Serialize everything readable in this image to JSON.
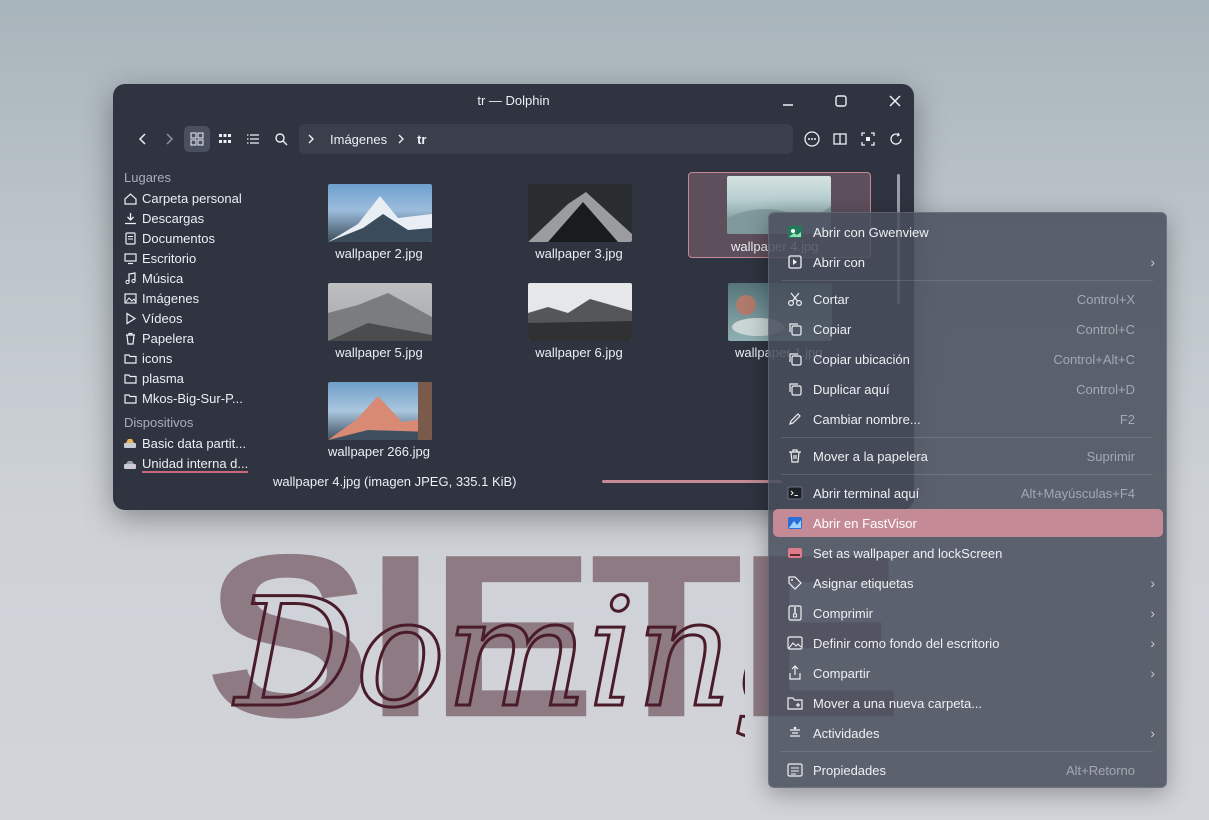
{
  "window": {
    "title": "tr — Dolphin"
  },
  "toolbar": {
    "breadcrumb": [
      "Imágenes",
      "tr"
    ]
  },
  "sidebar": {
    "places_title": "Lugares",
    "places": [
      {
        "label": "Carpeta personal",
        "icon": "home-icon"
      },
      {
        "label": "Descargas",
        "icon": "download-icon"
      },
      {
        "label": "Documentos",
        "icon": "document-icon"
      },
      {
        "label": "Escritorio",
        "icon": "desktop-icon"
      },
      {
        "label": "Música",
        "icon": "music-icon"
      },
      {
        "label": "Imágenes",
        "icon": "image-icon"
      },
      {
        "label": "Vídeos",
        "icon": "video-icon"
      },
      {
        "label": "Papelera",
        "icon": "trash-icon"
      },
      {
        "label": "icons",
        "icon": "folder-icon"
      },
      {
        "label": "plasma",
        "icon": "folder-icon"
      },
      {
        "label": "Mkos-Big-Sur-P...",
        "icon": "folder-icon"
      }
    ],
    "devices_title": "Dispositivos",
    "devices": [
      {
        "label": "Basic data partit...",
        "icon": "drive-icon"
      },
      {
        "label": "Unidad interna d...",
        "icon": "drive-icon"
      }
    ]
  },
  "files": [
    {
      "name": "wallpaper 2.jpg",
      "palette": [
        "#6f9fcf",
        "#e8eef4",
        "#3a4b5b"
      ]
    },
    {
      "name": "wallpaper 3.jpg",
      "palette": [
        "#2a2d30",
        "#d8dadc",
        "#1a1b1d"
      ]
    },
    {
      "name": "wallpaper 4.jpg",
      "palette": [
        "#b8cfd1",
        "#8fa7ab",
        "#6f8a8e"
      ]
    },
    {
      "name": "wallpaper 5.jpg",
      "palette": [
        "#bdbfc1",
        "#7a7c7e",
        "#4a4c4e"
      ]
    },
    {
      "name": "wallpaper 6.jpg",
      "palette": [
        "#e6e7e8",
        "#545658",
        "#2f3133"
      ]
    },
    {
      "name": "wallpaper 1.jpg",
      "palette": [
        "#55757a",
        "#b07a6c",
        "#8fb0b3"
      ]
    },
    {
      "name": "wallpaper 266.jpg",
      "palette": [
        "#6e9ec8",
        "#d98a74",
        "#3f4f5f"
      ]
    }
  ],
  "status": {
    "text": "wallpaper 4.jpg (imagen JPEG, 335.1 KiB)"
  },
  "context_menu": {
    "items": [
      {
        "label": "Abrir con Gwenview",
        "shortcut": "",
        "submenu": false,
        "icon": "gwenview-icon"
      },
      {
        "label": "Abrir con",
        "shortcut": "",
        "submenu": true,
        "icon": "open-with-icon"
      },
      {
        "label": "Cortar",
        "shortcut": "Control+X",
        "submenu": false,
        "icon": "cut-icon"
      },
      {
        "label": "Copiar",
        "shortcut": "Control+C",
        "submenu": false,
        "icon": "copy-icon"
      },
      {
        "label": "Copiar ubicación",
        "shortcut": "Control+Alt+C",
        "submenu": false,
        "icon": "copy-location-icon"
      },
      {
        "label": "Duplicar aquí",
        "shortcut": "Control+D",
        "submenu": false,
        "icon": "duplicate-icon"
      },
      {
        "label": "Cambiar nombre...",
        "shortcut": "F2",
        "submenu": false,
        "icon": "rename-icon"
      },
      {
        "label": "Mover a la papelera",
        "shortcut": "Suprimir",
        "submenu": false,
        "icon": "trash-icon"
      },
      {
        "label": "Abrir terminal aquí",
        "shortcut": "Alt+Mayúsculas+F4",
        "submenu": false,
        "icon": "terminal-icon"
      },
      {
        "label": "Abrir en FastVisor",
        "shortcut": "",
        "submenu": false,
        "icon": "fastvisor-icon"
      },
      {
        "label": "Set as wallpaper and lockScreen",
        "shortcut": "",
        "submenu": false,
        "icon": "wallpaper-icon"
      },
      {
        "label": "Asignar etiquetas",
        "shortcut": "",
        "submenu": true,
        "icon": "tag-icon"
      },
      {
        "label": "Comprimir",
        "shortcut": "",
        "submenu": true,
        "icon": "compress-icon"
      },
      {
        "label": "Definir como fondo del escritorio",
        "shortcut": "",
        "submenu": true,
        "icon": "image-icon"
      },
      {
        "label": "Compartir",
        "shortcut": "",
        "submenu": true,
        "icon": "share-icon"
      },
      {
        "label": "Mover a una nueva carpeta...",
        "shortcut": "",
        "submenu": false,
        "icon": "new-folder-icon"
      },
      {
        "label": "Actividades",
        "shortcut": "",
        "submenu": true,
        "icon": "activities-icon"
      },
      {
        "label": "Propiedades",
        "shortcut": "Alt+Retorno",
        "submenu": false,
        "icon": "properties-icon"
      }
    ],
    "highlighted": "Abrir en FastVisor"
  },
  "wallpaper": {
    "big_text": "SIETE",
    "script_text": "Domingo"
  },
  "colors": {
    "accent": "#c48a96",
    "window_bg": "#2f3440",
    "menu_bg": "#484e5c"
  }
}
